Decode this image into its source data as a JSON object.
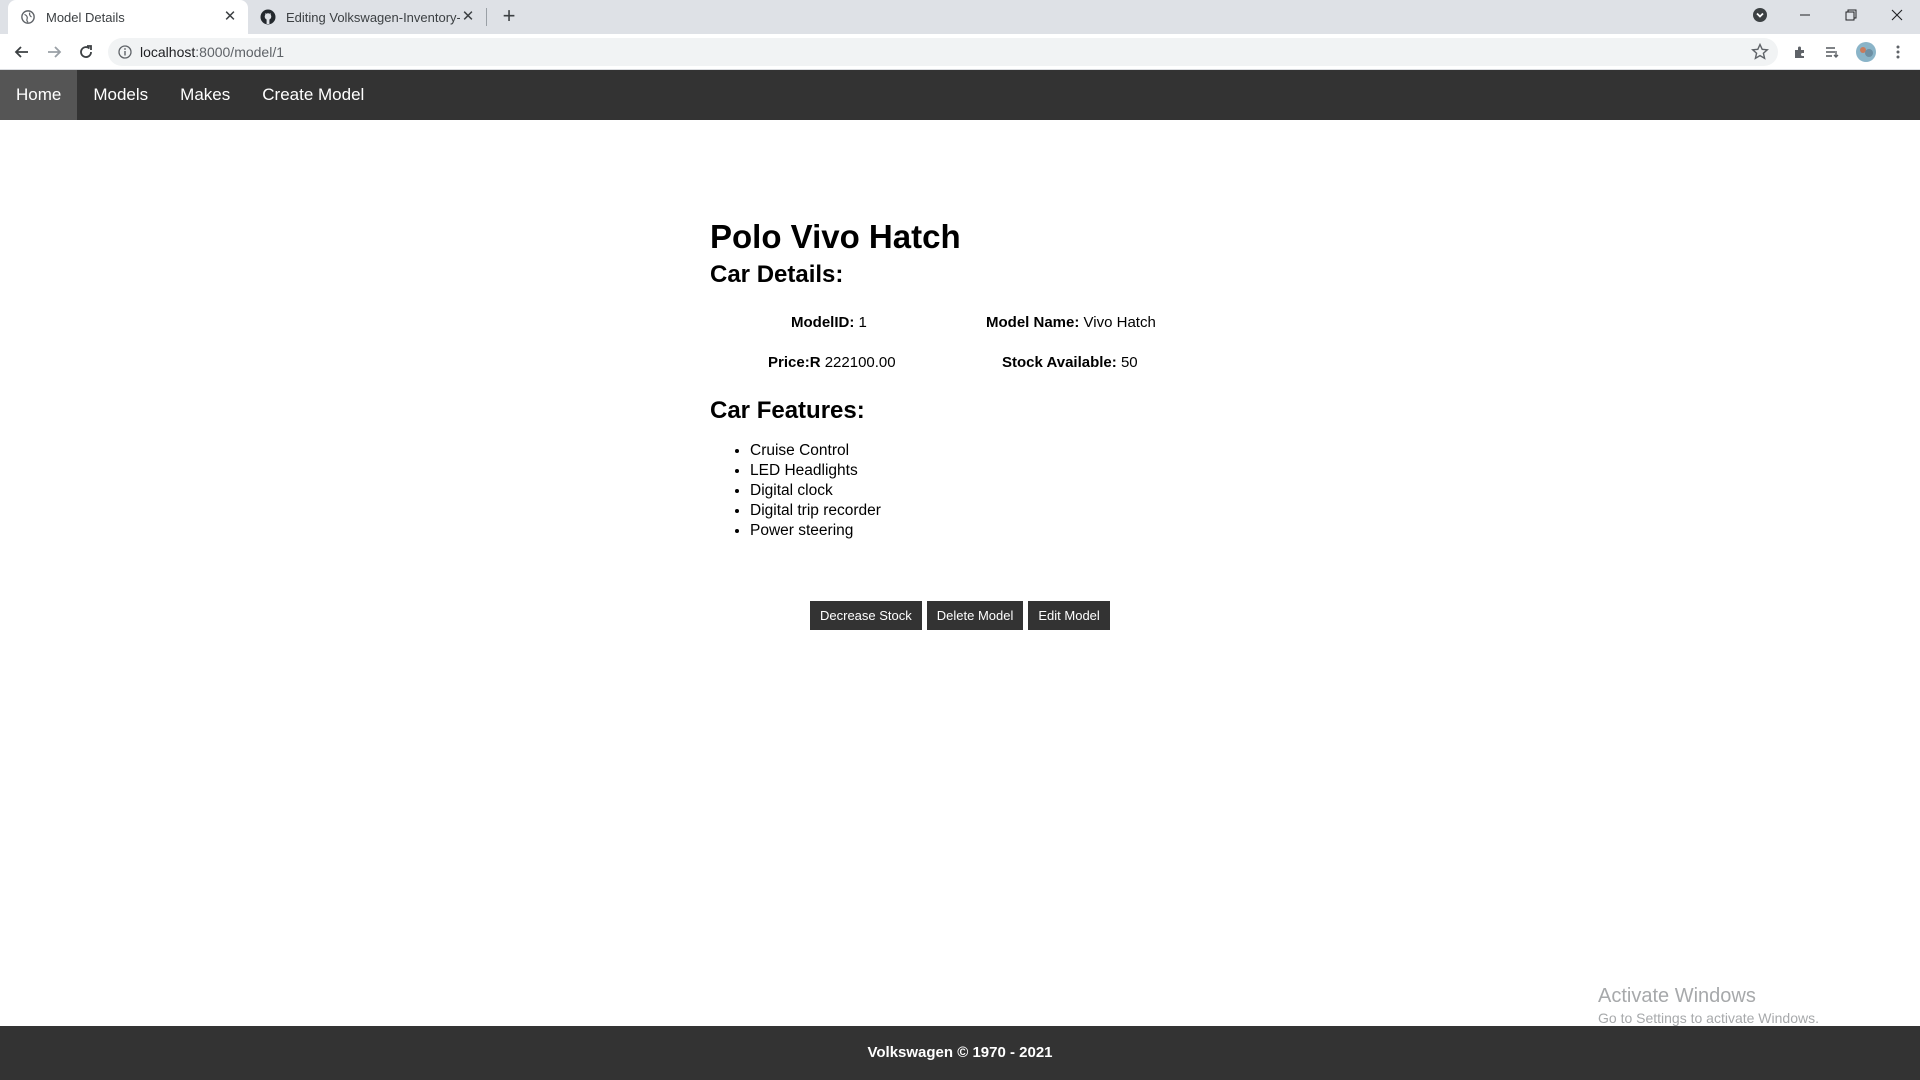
{
  "browser": {
    "tabs": [
      {
        "title": "Model Details",
        "active": true
      },
      {
        "title": "Editing Volkswagen-Inventory-M",
        "active": false
      }
    ],
    "url_host": "localhost",
    "url_path": ":8000/model/1"
  },
  "nav": {
    "items": [
      "Home",
      "Models",
      "Makes",
      "Create Model"
    ],
    "active": "Home"
  },
  "model": {
    "title": "Polo Vivo Hatch",
    "details_heading": "Car Details:",
    "modelid_label": "ModelID:",
    "modelid_value": "1",
    "name_label": "Model Name:",
    "name_value": "Vivo Hatch",
    "price_label": "Price:R",
    "price_value": "222100.00",
    "stock_label": "Stock Available:",
    "stock_value": "50",
    "features_heading": "Car Features:",
    "features": [
      "Cruise Control",
      "LED Headlights",
      "Digital clock",
      "Digital trip recorder",
      "Power steering"
    ]
  },
  "actions": {
    "decrease": "Decrease Stock",
    "delete": "Delete Model",
    "edit": "Edit Model"
  },
  "footer": {
    "text": "Volkswagen © 1970 - 2021"
  },
  "watermark": {
    "line1": "Activate Windows",
    "line2": "Go to Settings to activate Windows."
  }
}
